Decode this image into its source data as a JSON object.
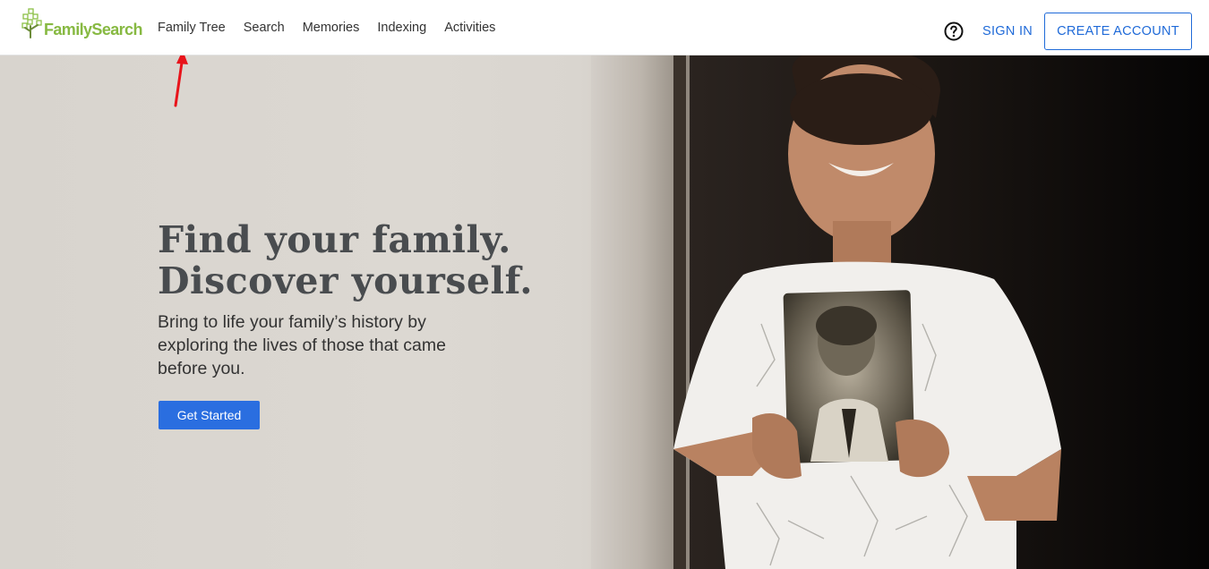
{
  "header": {
    "logo_text": "FamilySearch",
    "nav": [
      {
        "label": "Family Tree"
      },
      {
        "label": "Search"
      },
      {
        "label": "Memories"
      },
      {
        "label": "Indexing"
      },
      {
        "label": "Activities"
      }
    ],
    "help_icon": "help-circle-icon",
    "sign_in": "SIGN IN",
    "create_account": "CREATE ACCOUNT"
  },
  "hero": {
    "headline_line1": "Find your family.",
    "headline_line2": "Discover yourself.",
    "subtext": "Bring to life your family’s history by exploring the lives of those that came before you.",
    "cta": "Get Started",
    "image": "boy-holding-vintage-portrait-photo"
  },
  "annotation": {
    "icon": "red-arrow-icon",
    "color": "#e8141b"
  },
  "colors": {
    "brand_green": "#87b942",
    "link_blue": "#1f6ad8",
    "button_blue": "#2a6ee0",
    "hero_bg": "#d9d5cf"
  }
}
